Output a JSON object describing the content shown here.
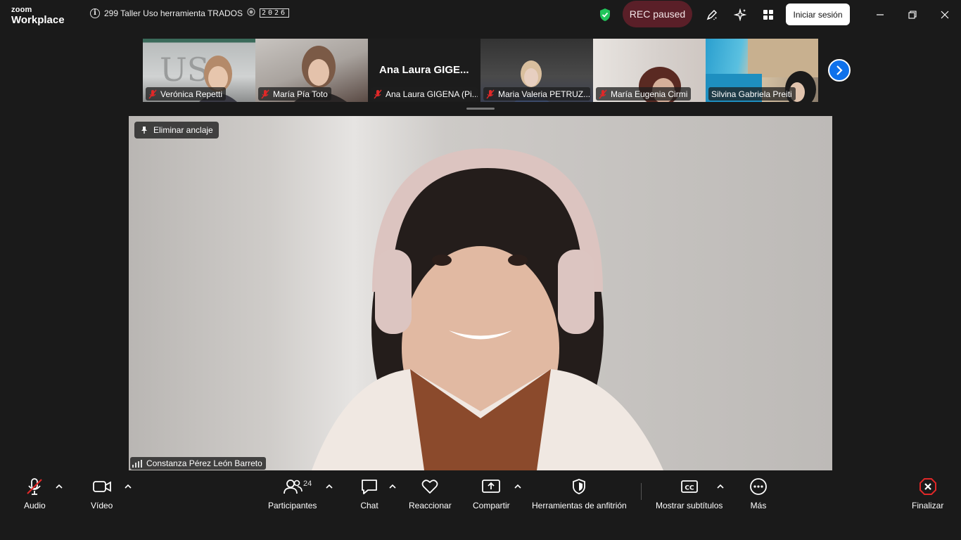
{
  "app": {
    "logo_top": "zoom",
    "logo_bottom": "Workplace"
  },
  "meeting": {
    "title": "299 Taller Uso herramienta TRADOS",
    "badge": "2026"
  },
  "titlebar": {
    "rec_label": "REC paused",
    "signin_label": "Iniciar sesión"
  },
  "participants_strip": [
    {
      "name": "Verónica Repetti",
      "muted": true
    },
    {
      "name": "María Pía Toto",
      "muted": true
    },
    {
      "name": "Ana Laura GIGENA (Pi...",
      "big_name": "Ana Laura GIGE...",
      "muted": true
    },
    {
      "name": "Maria Valeria PETRUZ...",
      "muted": true
    },
    {
      "name": "María Eugenia Cirmi",
      "muted": true
    },
    {
      "name": "Silvina Gabriela Preiti",
      "muted": false
    }
  ],
  "main": {
    "unpin_label": "Eliminar anclaje",
    "speaker": "Constanza Pérez León Barreto"
  },
  "toolbar": {
    "audio": "Audio",
    "video": "Vídeo",
    "participants": "Participantes",
    "participants_count": "24",
    "chat": "Chat",
    "react": "Reaccionar",
    "share": "Compartir",
    "host_tools": "Herramientas de anfitrión",
    "captions": "Mostrar subtítulos",
    "more": "Más",
    "end": "Finalizar"
  },
  "colors": {
    "accent": "#0e71eb",
    "rec_bg": "#5a1f28",
    "muted_red": "#e02828",
    "end_red": "#e02828",
    "shield_green": "#21c45a"
  }
}
